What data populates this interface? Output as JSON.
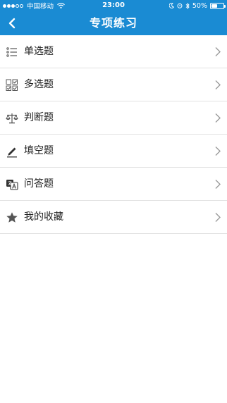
{
  "status_bar": {
    "carrier": "中国移动",
    "time": "23:00",
    "battery_text": "50%",
    "battery_level": 0.5,
    "signal_bars_filled": 3,
    "signal_bars_total": 5
  },
  "nav": {
    "title": "专项练习",
    "back_icon": "chevron-left-icon",
    "accent_color": "#1a8bd3"
  },
  "menu": {
    "items": [
      {
        "label": "单选题",
        "icon": "single-choice-list-icon"
      },
      {
        "label": "多选题",
        "icon": "multiple-choice-checkbox-icon"
      },
      {
        "label": "判断题",
        "icon": "scale-icon"
      },
      {
        "label": "填空题",
        "icon": "pencil-icon"
      },
      {
        "label": "问答题",
        "icon": "translate-qa-icon"
      },
      {
        "label": "我的收藏",
        "icon": "star-icon"
      }
    ]
  }
}
